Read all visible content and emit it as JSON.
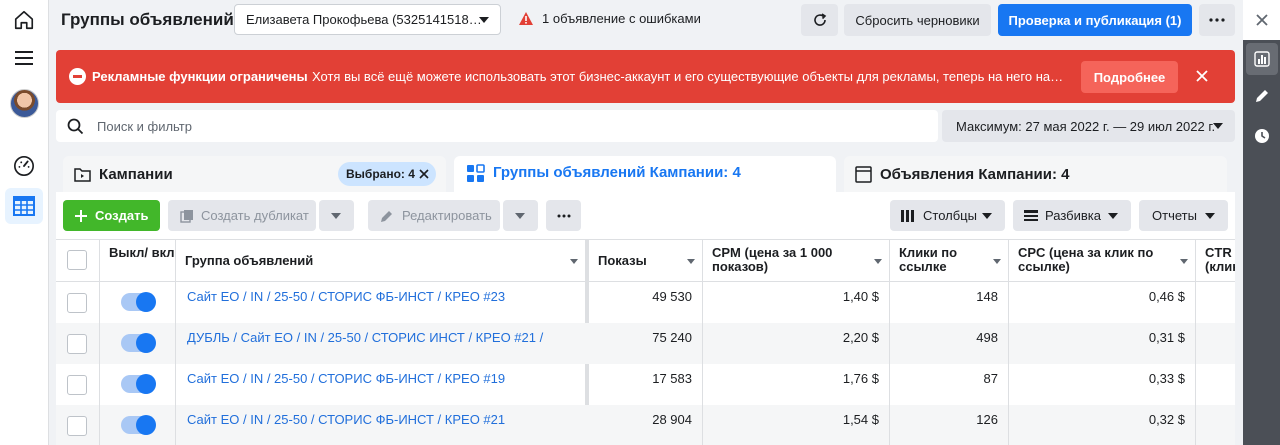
{
  "app": {
    "title": "Группы объявлений",
    "account": "Елизавета Прокофьева (5325141518…",
    "error_notice": "1 объявление с ошибками",
    "discard_label": "Сбросить черновики",
    "publish_label": "Проверка и публикация (1)"
  },
  "alert": {
    "title": "Рекламные функции ограничены",
    "text": "Хотя вы всё ещё можете использовать этот бизнес-аккаунт и его существующие объекты для рекламы, теперь на него налагаются ограничения",
    "more_label": "Подробнее"
  },
  "search": {
    "placeholder": "Поиск и фильтр",
    "date_range": "Максимум: 27 мая 2022 г. — 29 июл 2022 г."
  },
  "tabs": {
    "campaigns": "Кампании",
    "selected_pill": "Выбрано: 4",
    "adsets": "Группы объявлений Кампании: 4",
    "ads": "Объявления Кампании: 4"
  },
  "toolbar": {
    "create": "Создать",
    "duplicate": "Создать дубликат",
    "edit": "Редактировать",
    "columns": "Столбцы",
    "breakdown": "Разбивка",
    "reports": "Отчеты"
  },
  "columns": {
    "toggle": "Выкл/ вкл",
    "name": "Группа объявлений",
    "impressions": "Показы",
    "cpm": "CPM (цена за 1 000 показов)",
    "clicks": "Клики по ссылке",
    "cpc": "CPC (цена за клик по ссылке)",
    "ctr": "CTR (клик"
  },
  "rows": [
    {
      "name": "Сайт ЕО / IN / 25-50 / СТОРИС ФБ-ИНСТ / КРЕО #23",
      "impressions": "49 530",
      "cpm": "1,40 $",
      "clicks": "148",
      "cpc": "0,46 $"
    },
    {
      "name": "ДУБЛЬ / Сайт ЕО / IN / 25-50 / СТОРИС ИНСТ / КРЕО #21 /",
      "impressions": "75 240",
      "cpm": "2,20 $",
      "clicks": "498",
      "cpc": "0,31 $"
    },
    {
      "name": "Сайт ЕО / IN / 25-50 / СТОРИС ФБ-ИНСТ / КРЕО #19",
      "impressions": "17 583",
      "cpm": "1,76 $",
      "clicks": "87",
      "cpc": "0,33 $"
    },
    {
      "name": "Сайт ЕО / IN / 25-50 / СТОРИС ФБ-ИНСТ / КРЕО #21",
      "impressions": "28 904",
      "cpm": "1,54 $",
      "clicks": "126",
      "cpc": "0,32 $"
    }
  ],
  "colors": {
    "primary": "#1877f2",
    "alert": "#e24036",
    "create": "#42b72a",
    "link": "#216fdb"
  }
}
